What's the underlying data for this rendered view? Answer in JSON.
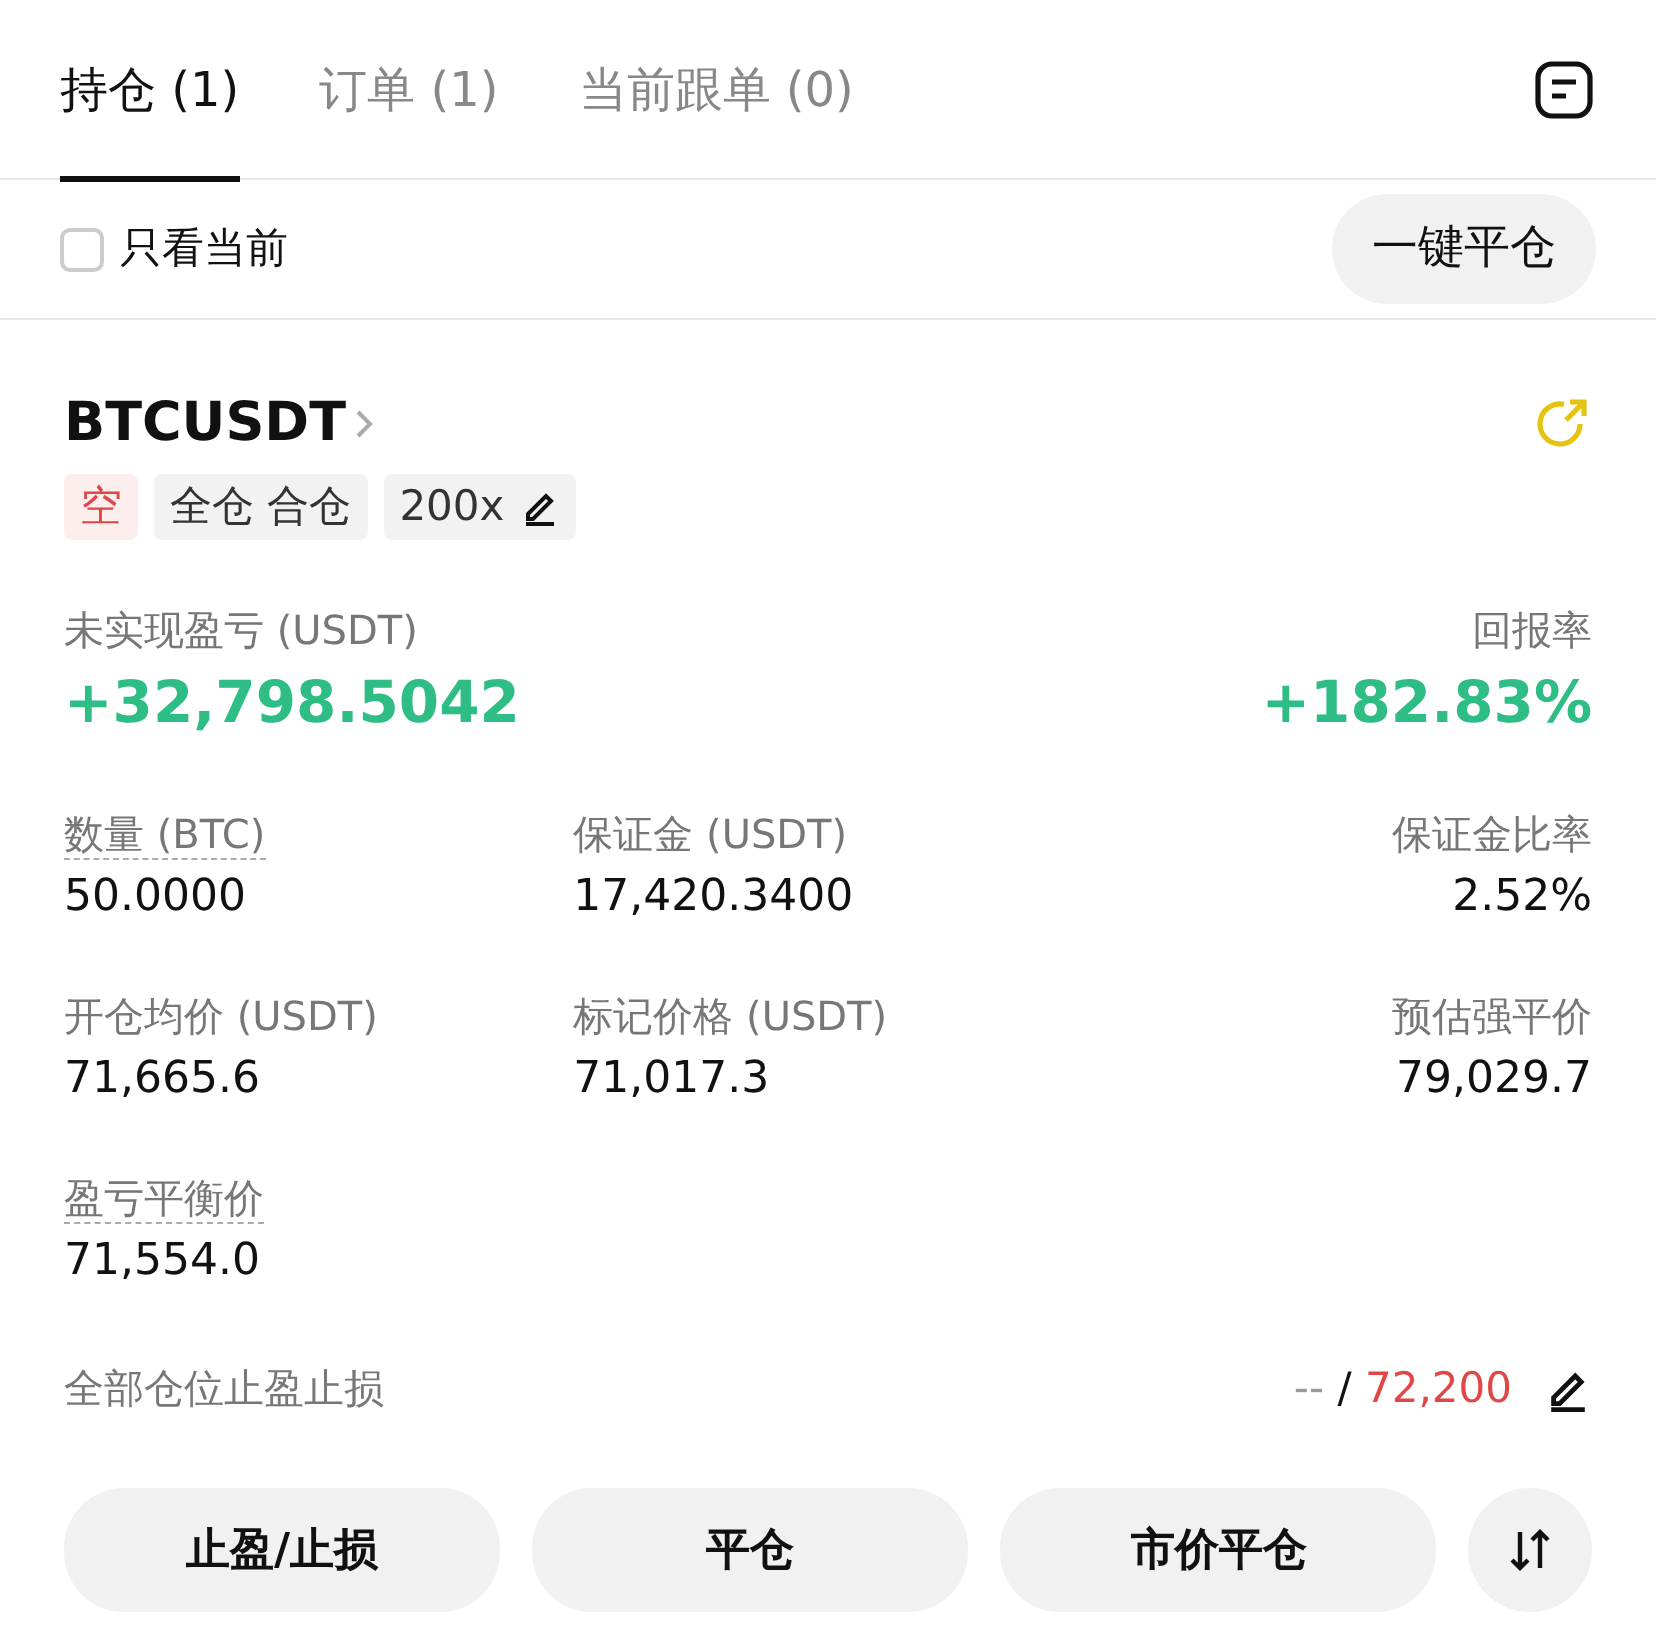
{
  "tabs": [
    {
      "label": "持仓 (1)",
      "selected": true
    },
    {
      "label": "订单 (1)",
      "selected": false
    },
    {
      "label": "当前跟单 (0)",
      "selected": false
    }
  ],
  "filter": {
    "label": "只看当前",
    "checked": false
  },
  "close_all_button": "一键平仓",
  "position": {
    "symbol": "BTCUSDT",
    "tags": [
      {
        "label": "空",
        "kind": "side"
      },
      {
        "label": "全仓 合仓",
        "kind": "plain"
      },
      {
        "label": "200x",
        "kind": "leverage"
      }
    ],
    "pnl_label": "未实现盈亏 (USDT)",
    "pnl_value": "+32,798.5042",
    "roe_label": "回报率",
    "roe_value": "+182.83%",
    "fields": [
      {
        "label": "数量 (BTC)",
        "value": "50.0000",
        "dotted": true
      },
      {
        "label": "保证金 (USDT)",
        "value": "17,420.3400",
        "dotted": false
      },
      {
        "label": "保证金比率",
        "value": "2.52%",
        "dotted": false
      },
      {
        "label": "开仓均价 (USDT)",
        "value": "71,665.6",
        "dotted": false
      },
      {
        "label": "标记价格 (USDT)",
        "value": "71,017.3",
        "dotted": false
      },
      {
        "label": "预估强平价",
        "value": "79,029.7",
        "dotted": false
      },
      {
        "label": "盈亏平衡价",
        "value": "71,554.0",
        "dotted": true
      }
    ],
    "tpsl_label": "全部仓位止盈止损",
    "tpsl_tp": "--",
    "tpsl_sep": "/",
    "tpsl_sl": "72,200"
  },
  "actions": [
    "止盈/止损",
    "平仓",
    "市价平仓"
  ]
}
